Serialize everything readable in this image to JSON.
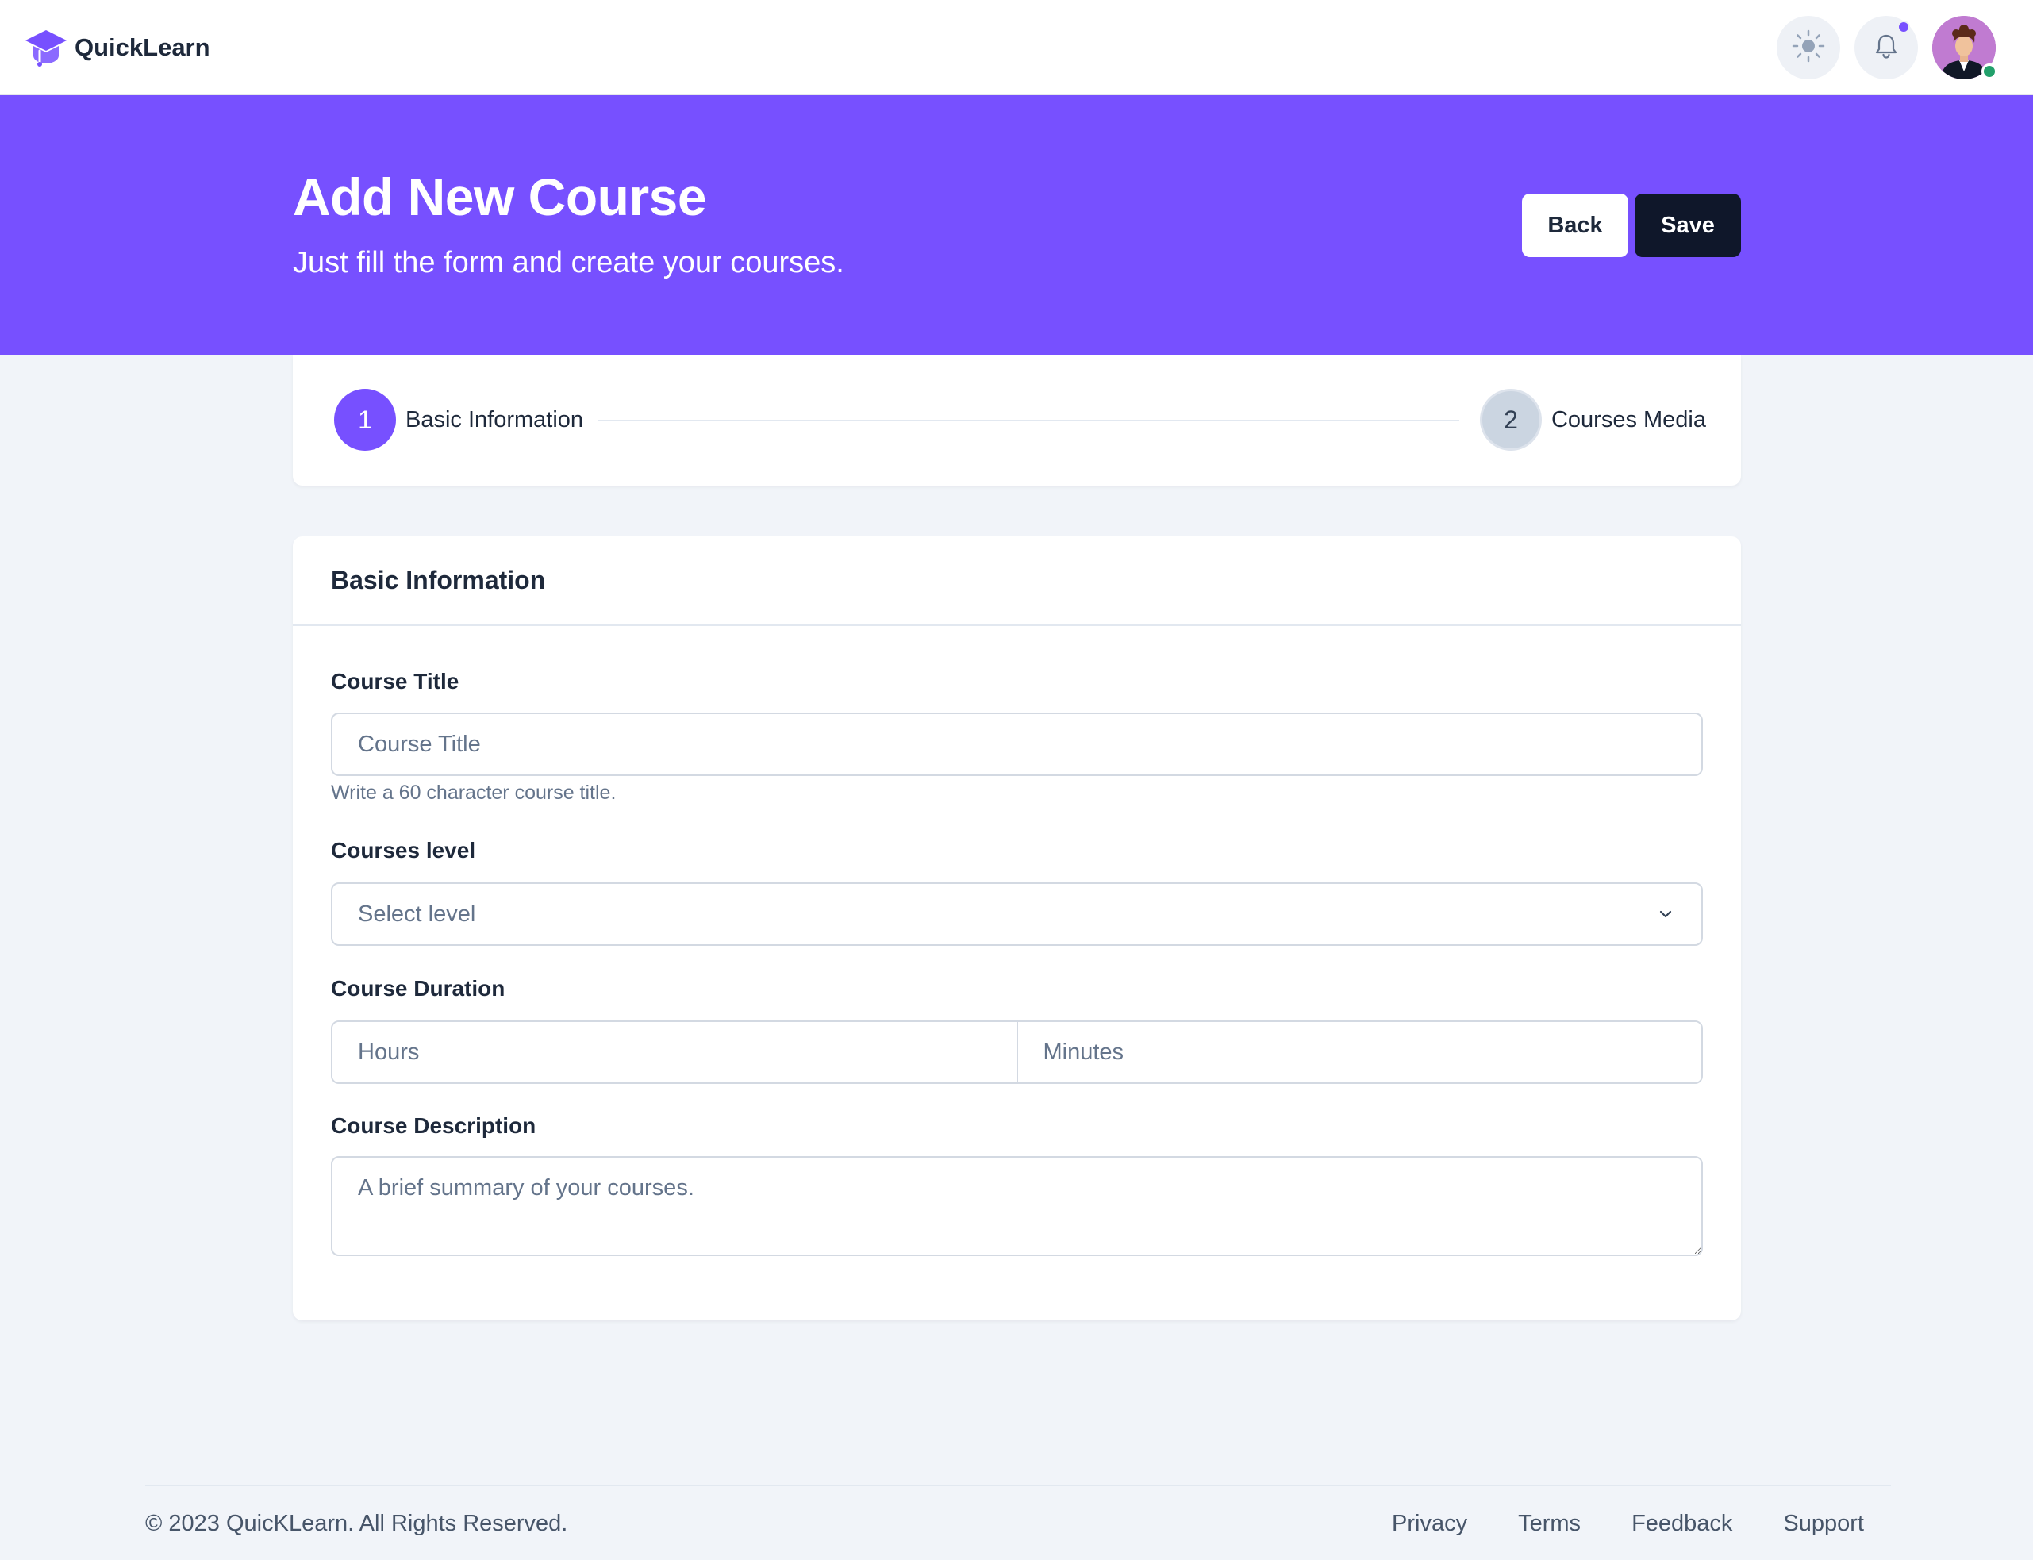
{
  "brand": {
    "name": "QuickLearn",
    "icon": "graduation-cap-icon",
    "color": "#7750ff"
  },
  "nav": {
    "theme_icon": "sun-icon",
    "notification_icon": "bell-icon",
    "avatar": "user-avatar",
    "has_unread_notifications": true,
    "user_online": true
  },
  "hero": {
    "title": "Add New Course",
    "subtitle": "Just fill the form and create your courses.",
    "back_label": "Back",
    "save_label": "Save",
    "background": "#7750ff"
  },
  "stepper": {
    "steps": [
      {
        "number": "1",
        "label": "Basic Information",
        "active": true
      },
      {
        "number": "2",
        "label": "Courses Media",
        "active": false
      }
    ]
  },
  "form": {
    "title": "Basic Information",
    "course_title": {
      "label": "Course Title",
      "placeholder": "Course Title",
      "value": "",
      "help": "Write a 60 character course title."
    },
    "level": {
      "label": "Courses level",
      "selected": "Select level"
    },
    "duration": {
      "label": "Course Duration",
      "hours_placeholder": "Hours",
      "minutes_placeholder": "Minutes"
    },
    "description": {
      "label": "Course Description",
      "placeholder": "A brief summary of your courses."
    }
  },
  "footer": {
    "copyright": "© 2023 QuicKLearn. All Rights Reserved.",
    "links": [
      "Privacy",
      "Terms",
      "Feedback",
      "Support"
    ]
  }
}
